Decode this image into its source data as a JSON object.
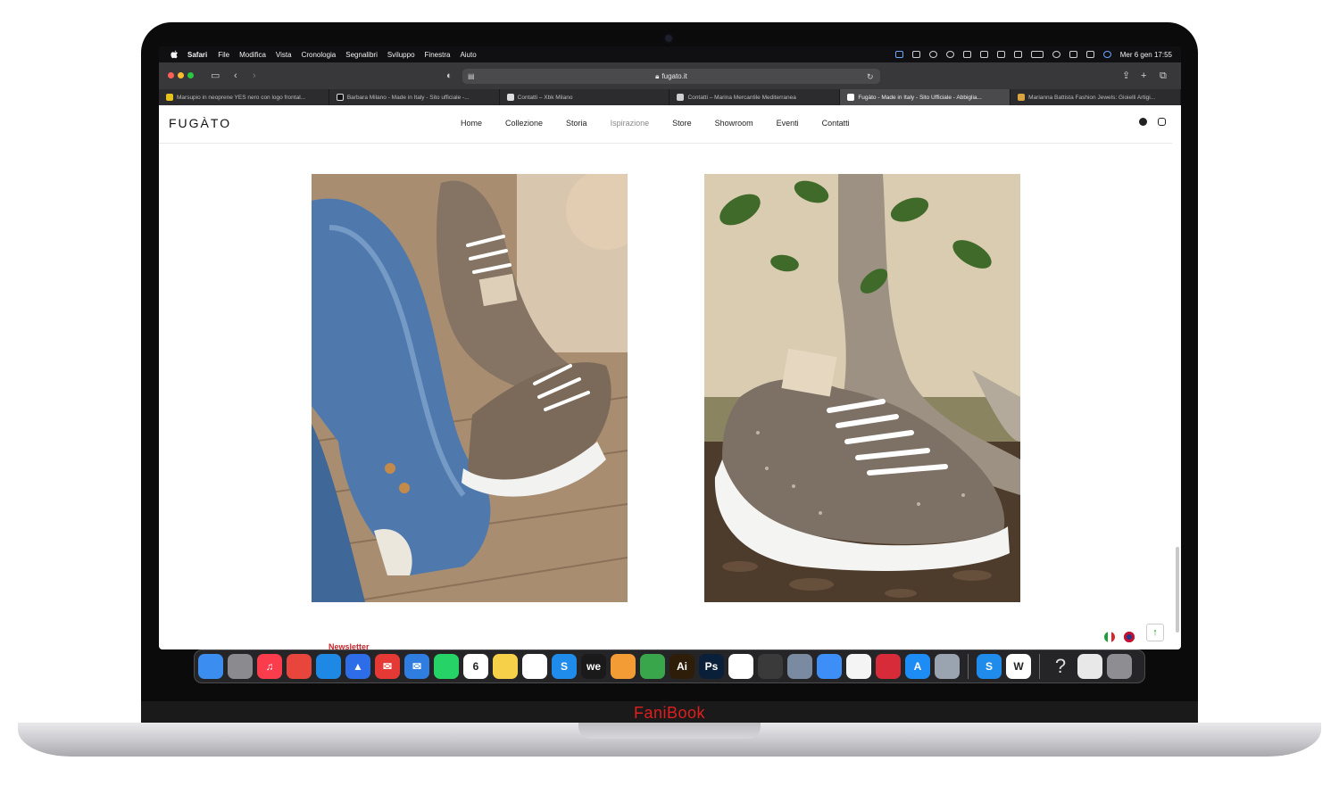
{
  "menubar": {
    "app_name": "Safari",
    "items": [
      "File",
      "Modifica",
      "Vista",
      "Cronologia",
      "Segnalibri",
      "Sviluppo",
      "Finestra",
      "Aiuto"
    ],
    "clock": "Mer 6 gen  17:55"
  },
  "safari": {
    "address": "fugato.it",
    "tabs": [
      {
        "label": "Marsupio in neoprene YES nero con logo frontal...",
        "active": false
      },
      {
        "label": "Barbara Milano - Made in Italy - Sito ufficiale -...",
        "active": false
      },
      {
        "label": "Contatti – Xbk Milano",
        "active": false
      },
      {
        "label": "Contatti – Marina Mercantile Mediterranea",
        "active": false
      },
      {
        "label": "Fugàto - Made in Italy - Sito Ufficiale - Abbiglia...",
        "active": true
      },
      {
        "label": "Marianna Battista Fashion Jewels: Gioielli Artigi...",
        "active": false
      }
    ]
  },
  "site": {
    "logo": "FUGÀTO",
    "nav": [
      "Home",
      "Collezione",
      "Storia",
      "Ispirazione",
      "Store",
      "Showroom",
      "Eventi",
      "Contatti"
    ],
    "active_nav": "Ispirazione",
    "newsletter": "Newsletter",
    "brand_color": "#c4272e"
  },
  "laptop": {
    "brand": "FaniBook",
    "brand_color": "#e01e1e"
  },
  "dock": {
    "apps": [
      {
        "name": "finder",
        "color": "#3b8ef0",
        "glyph": ""
      },
      {
        "name": "system-preferences",
        "color": "#8a8a8f",
        "glyph": ""
      },
      {
        "name": "music",
        "color": "#fa3c4c",
        "glyph": "♫"
      },
      {
        "name": "chrome",
        "color": "#e8453c",
        "glyph": ""
      },
      {
        "name": "safari",
        "color": "#1e88e5",
        "glyph": ""
      },
      {
        "name": "navigation",
        "color": "#2d6ee8",
        "glyph": "▲"
      },
      {
        "name": "mail-red",
        "color": "#e53935",
        "glyph": "✉"
      },
      {
        "name": "mail",
        "color": "#2f7de1",
        "glyph": "✉"
      },
      {
        "name": "whatsapp",
        "color": "#25d366",
        "glyph": ""
      },
      {
        "name": "calendar",
        "color": "#ffffff",
        "glyph": "6"
      },
      {
        "name": "notes",
        "color": "#f7d04a",
        "glyph": ""
      },
      {
        "name": "reminders",
        "color": "#ffffff",
        "glyph": ""
      },
      {
        "name": "skype",
        "color": "#1f8ceb",
        "glyph": "S"
      },
      {
        "name": "wetransfer",
        "color": "#1a1a1a",
        "glyph": "we"
      },
      {
        "name": "pages",
        "color": "#f39c35",
        "glyph": ""
      },
      {
        "name": "numbers",
        "color": "#3aa64b",
        "glyph": ""
      },
      {
        "name": "illustrator",
        "color": "#2e1d08",
        "glyph": "Ai"
      },
      {
        "name": "photoshop",
        "color": "#0a1f3a",
        "glyph": "Ps"
      },
      {
        "name": "acrobat",
        "color": "#ffffff",
        "glyph": ""
      },
      {
        "name": "final-cut",
        "color": "#3a3a3a",
        "glyph": ""
      },
      {
        "name": "launchpad",
        "color": "#7a8aa0",
        "glyph": ""
      },
      {
        "name": "keynote",
        "color": "#3e8ef7",
        "glyph": ""
      },
      {
        "name": "photos",
        "color": "#f4f4f4",
        "glyph": ""
      },
      {
        "name": "creative-cloud",
        "color": "#d72b3a",
        "glyph": ""
      },
      {
        "name": "app-store",
        "color": "#1d8df5",
        "glyph": "A"
      },
      {
        "name": "preview",
        "color": "#9aa3b0",
        "glyph": ""
      },
      {
        "name": "skype-2",
        "color": "#1f8ceb",
        "glyph": "S"
      },
      {
        "name": "word",
        "color": "#ffffff",
        "glyph": "W"
      },
      {
        "name": "help",
        "color": "transparent",
        "glyph": "?"
      },
      {
        "name": "screenshot",
        "color": "#e8e8e8",
        "glyph": ""
      },
      {
        "name": "trash",
        "color": "#8d8d92",
        "glyph": ""
      }
    ]
  }
}
